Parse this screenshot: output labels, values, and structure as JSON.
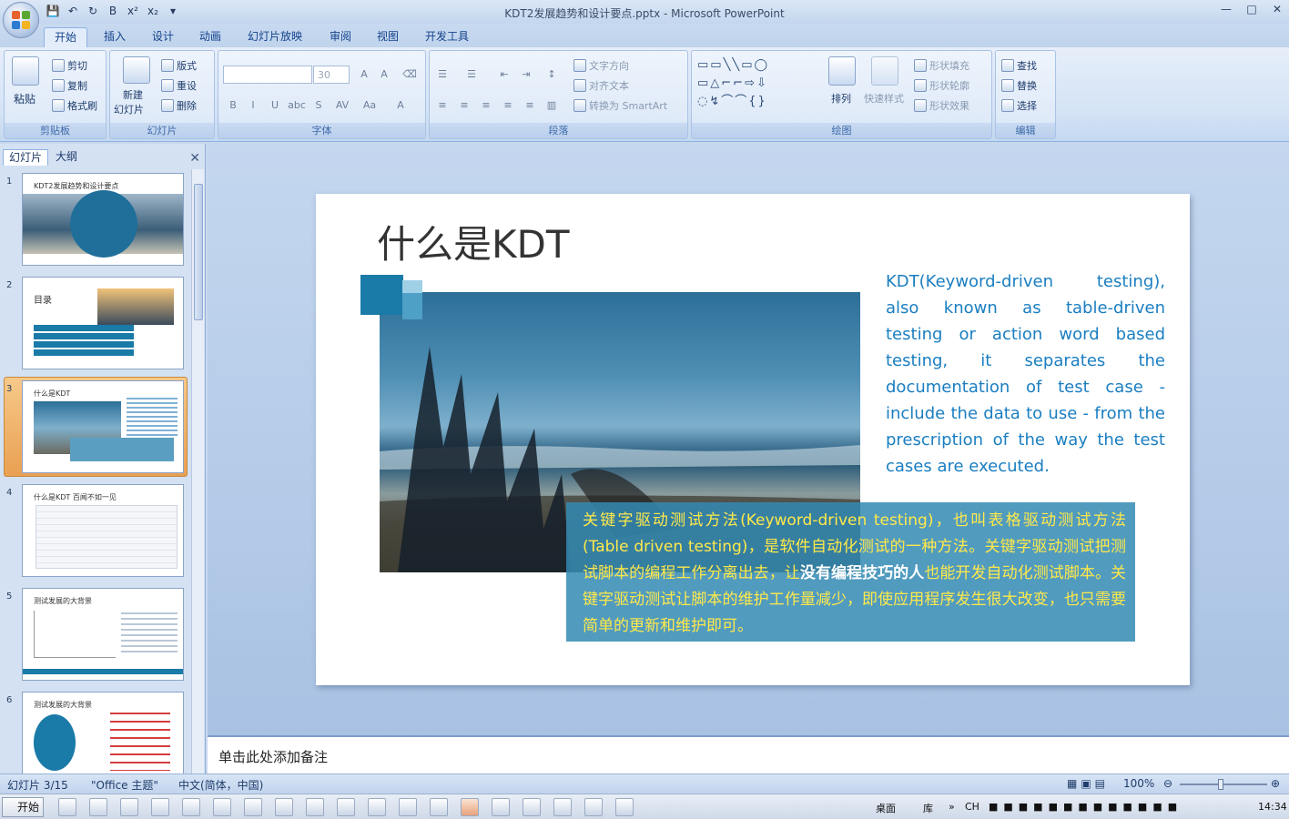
{
  "window": {
    "title": "KDT2发展趋势和设计要点.pptx - Microsoft PowerPoint",
    "controls": [
      "—",
      "□",
      "✕"
    ]
  },
  "qat": [
    "💾",
    "↶",
    "↻",
    "B",
    "x²",
    "x₂",
    "▾"
  ],
  "tabs": [
    "开始",
    "插入",
    "设计",
    "动画",
    "幻灯片放映",
    "审阅",
    "视图",
    "开发工具"
  ],
  "ribbon": {
    "clipboard": {
      "label": "剪贴板",
      "paste": "粘贴",
      "cut": "剪切",
      "copy": "复制",
      "format_painter": "格式刷"
    },
    "slides": {
      "label": "幻灯片",
      "new_slide_line1": "新建",
      "new_slide_line2": "幻灯片",
      "layout": "版式",
      "reset": "重设",
      "delete": "删除"
    },
    "font": {
      "label": "字体",
      "size": "30",
      "buttons": [
        "B",
        "I",
        "U",
        "abc",
        "S",
        "AV",
        "Aa",
        "A"
      ]
    },
    "paragraph": {
      "label": "段落",
      "text_direction": "文字方向",
      "align_text": "对齐文本",
      "convert_smartart": "转换为 SmartArt"
    },
    "drawing": {
      "label": "绘图",
      "arrange": "排列",
      "quick_styles": "快速样式",
      "shape_fill": "形状填充",
      "shape_outline": "形状轮廓",
      "shape_effects": "形状效果"
    },
    "editing": {
      "label": "编辑",
      "find": "查找",
      "replace": "替换",
      "select": "选择"
    }
  },
  "left_panel": {
    "tabs": [
      "幻灯片",
      "大纲"
    ],
    "close": "✕",
    "thumbnails": [
      {
        "num": "1",
        "title": "KDT2发展趋势和设计要点"
      },
      {
        "num": "2",
        "title": "目录"
      },
      {
        "num": "3",
        "title": "什么是KDT"
      },
      {
        "num": "4",
        "title": "什么是KDT 百闻不如一见"
      },
      {
        "num": "5",
        "title": "测试发展的大背景"
      },
      {
        "num": "6",
        "title": "测试发展的大背景"
      }
    ]
  },
  "slide": {
    "title": "什么是KDT",
    "english_text": "KDT(Keyword-driven testing), also known as table-driven testing or action word based testing, it separates the documentation of test case - include the data to use - from the prescription of the way the test cases are executed.",
    "chinese_text_part1": "关键字驱动测试方法(Keyword-driven testing)，也叫表格驱动测试方法(Table driven testing)，是软件自动化测试的一种方法。关键字驱动测试把测试脚本的编程工作分离出去，让",
    "chinese_text_bold": "没有编程技巧的人",
    "chinese_text_part2": "也能开发自动化测试脚本。关键字驱动测试让脚本的维护工作量减少，即使应用程序发生很大改变，也只需要简单的更新和维护即可。",
    "colors": {
      "english": "#1a7ec1",
      "chinese": "#ffe94a",
      "box": "#328ab4"
    }
  },
  "notes_placeholder": "单击此处添加备注",
  "status": {
    "slide_counter": "幻灯片 3/15",
    "theme": "\"Office 主题\"",
    "language": "中文(简体，中国)",
    "zoom": "100%"
  },
  "taskbar": {
    "start": "开始",
    "desktop": "桌面",
    "library": "库",
    "input": "CH",
    "time": "14:34"
  }
}
